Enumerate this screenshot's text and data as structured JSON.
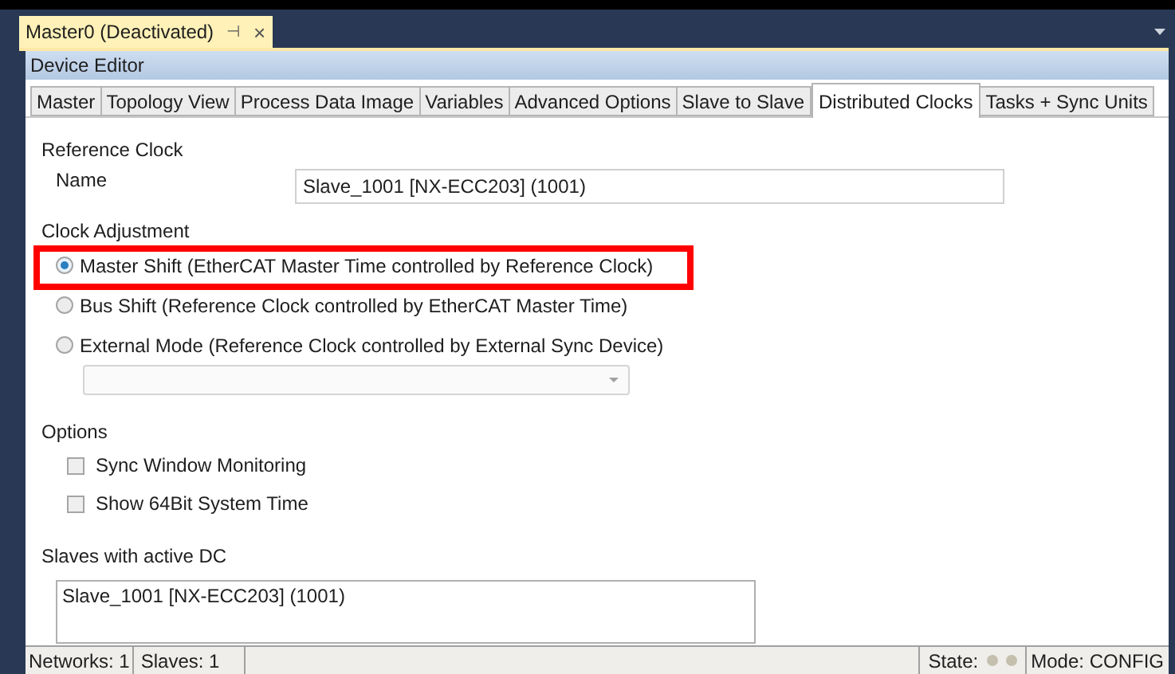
{
  "document_tab": {
    "title": "Master0 (Deactivated)",
    "pin": "⊣",
    "close": "×"
  },
  "panel_title": "Device Editor",
  "tabs": [
    {
      "label": "Master",
      "selected": false
    },
    {
      "label": "Topology View",
      "selected": false
    },
    {
      "label": "Process Data Image",
      "selected": false
    },
    {
      "label": "Variables",
      "selected": false
    },
    {
      "label": "Advanced Options",
      "selected": false
    },
    {
      "label": "Slave to Slave",
      "selected": false
    },
    {
      "label": "Distributed Clocks",
      "selected": true
    },
    {
      "label": "Tasks + Sync Units",
      "selected": false
    }
  ],
  "reference_clock": {
    "heading": "Reference Clock",
    "name_label": "Name",
    "name_value": "Slave_1001 [NX-ECC203] (1001)"
  },
  "clock_adjustment": {
    "heading": "Clock Adjustment",
    "options": [
      {
        "label": "Master Shift (EtherCAT Master Time controlled by Reference Clock)",
        "selected": true
      },
      {
        "label": "Bus Shift (Reference Clock controlled by EtherCAT Master Time)",
        "selected": false
      },
      {
        "label": "External Mode (Reference Clock controlled by External Sync Device)",
        "selected": false
      }
    ]
  },
  "options": {
    "heading": "Options",
    "items": [
      {
        "label": "Sync Window Monitoring",
        "checked": false
      },
      {
        "label": "Show 64Bit System Time",
        "checked": false
      }
    ]
  },
  "slaves_with_active_dc": {
    "heading": "Slaves with active DC",
    "items": [
      "Slave_1001 [NX-ECC203] (1001)"
    ]
  },
  "status_bar": {
    "networks": "Networks: 1",
    "slaves": "Slaves: 1",
    "state": "State:",
    "mode": "Mode: CONFIG"
  }
}
